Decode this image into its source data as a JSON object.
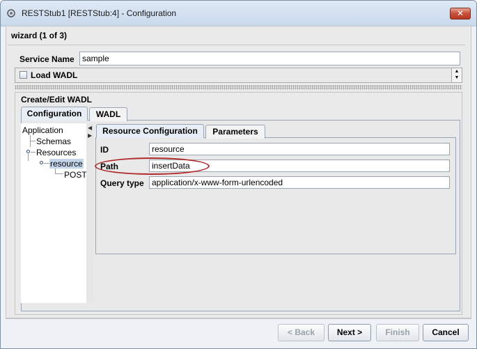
{
  "window": {
    "title": "RESTStub1 [RESTStub:4] - Configuration",
    "close_label": "✕"
  },
  "wizard": {
    "step_label": "wizard (1 of 3)"
  },
  "service": {
    "label": "Service Name",
    "value": "sample"
  },
  "wadl_loader": {
    "label": "Load WADL",
    "checked": false
  },
  "group": {
    "title": "Create/Edit WADL"
  },
  "tabs": [
    {
      "label": "Configuration",
      "active": true
    },
    {
      "label": "WADL",
      "active": false
    }
  ],
  "tree": {
    "items": [
      "Application",
      "Schemas",
      "Resources",
      "resource",
      "POST"
    ]
  },
  "inner_tabs": [
    {
      "label": "Resource Configuration",
      "active": true
    },
    {
      "label": "Parameters",
      "active": false
    }
  ],
  "fields": [
    {
      "label": "ID",
      "value": "resource"
    },
    {
      "label": "Path",
      "value": "insertData"
    },
    {
      "label": "Query type",
      "value": "application/x-www-form-urlencoded"
    }
  ],
  "buttons": {
    "back": "< Back",
    "next": "Next >",
    "finish": "Finish",
    "cancel": "Cancel"
  }
}
